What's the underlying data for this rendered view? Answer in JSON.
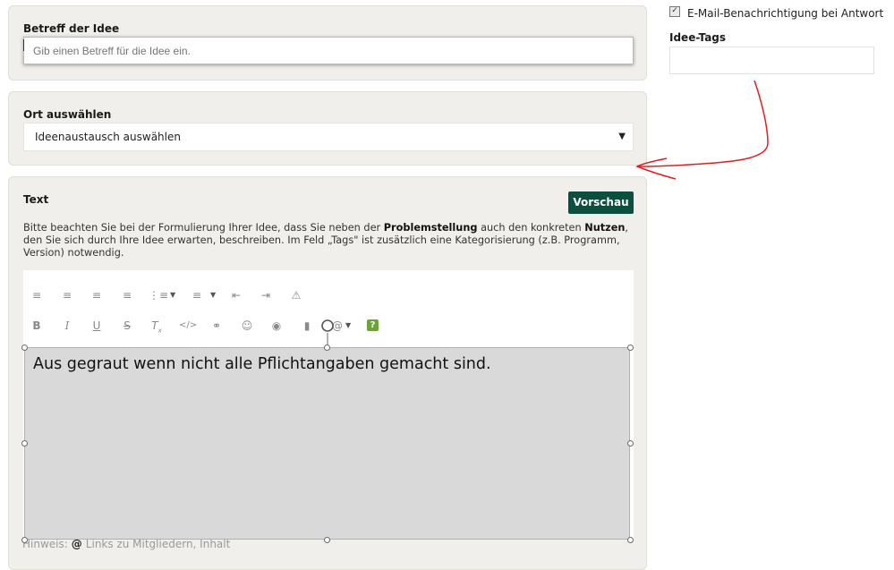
{
  "subject": {
    "label": "Betreff der Idee",
    "placeholder": "Gib einen Betreff für die Idee ein."
  },
  "location": {
    "label": "Ort auswählen",
    "selected": "Ideenaustausch auswählen"
  },
  "text": {
    "label": "Text",
    "preview_button": "Vorschau",
    "note_part1": "Bitte beachten Sie bei der Formulierung Ihrer Idee, dass Sie neben der ",
    "note_bold1": "Problemstellung",
    "note_part2": " auch den konkreten ",
    "note_bold2": "Nutzen",
    "note_part3": ", den Sie sich durch Ihre Idee erwarten, beschreiben. Im Feld „Tags\" ist zusätzlich eine Kategorisierung (z.B. Programm, Version) notwendig.",
    "toolbar_row1": [
      "align-left-icon",
      "align-center-icon",
      "align-right-icon",
      "align-justify-icon",
      "bullet-list-icon",
      "numbered-list-icon",
      "outdent-icon",
      "indent-icon",
      "warning-icon"
    ],
    "toolbar_row2": [
      "bold-icon",
      "italic-icon",
      "underline-icon",
      "strikethrough-icon",
      "clear-format-icon",
      "code-icon",
      "link-icon",
      "emoji-icon",
      "camera-icon",
      "video-icon",
      "mention-icon",
      "help-icon"
    ],
    "hint_label": "Hinweis:",
    "hint_at": "@",
    "hint_text": "Links zu Mitgliedern, Inhalt"
  },
  "overlay": {
    "text": "Aus gegraut wenn nicht alle Pflichtangaben gemacht sind."
  },
  "sidebar": {
    "email_notification": "E-Mail-Benachrichtigung bei Antwort",
    "email_checked": true,
    "tags_label": "Idee-Tags",
    "tags_value": ""
  },
  "colors": {
    "panel_bg": "#f1efeb",
    "preview_button_bg": "#0d4f3f",
    "annotation_red": "#e41e1e",
    "overlay_gray": "#d9d9d9"
  }
}
